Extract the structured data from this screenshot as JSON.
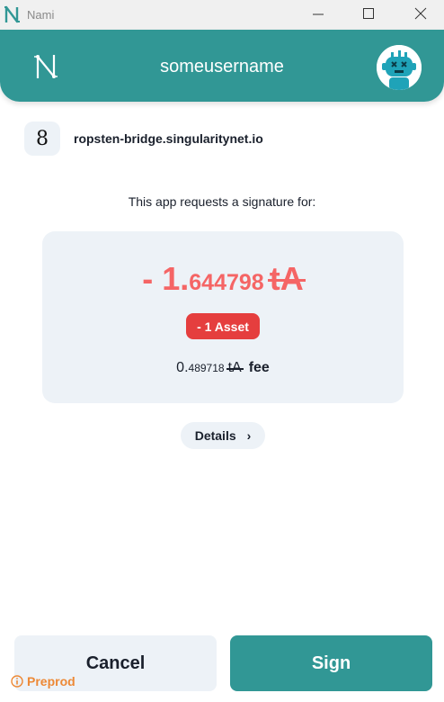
{
  "window": {
    "title": "Nami",
    "minimize_icon": "minimize-icon",
    "maximize_icon": "maximize-icon",
    "close_icon": "close-icon"
  },
  "header": {
    "username": "someusername",
    "logo_icon": "nami-logo-icon",
    "avatar_icon": "robot-avatar-icon",
    "background_color": "#319795"
  },
  "dapp": {
    "icon_glyph": "8",
    "url": "ropsten-bridge.singularitynet.io"
  },
  "request_text": "This app requests a signature for:",
  "summary": {
    "amount_prefix": "- 1.",
    "amount_decimals": "644798",
    "amount_currency": "tA",
    "amount_color": "#f56565",
    "asset_badge": "- 1 Asset",
    "badge_color": "#e53e3e",
    "fee_int": "0.",
    "fee_decimals": "489718",
    "fee_currency": "tA",
    "fee_label": "fee"
  },
  "details_button": {
    "label": "Details",
    "chevron": "›"
  },
  "actions": {
    "cancel_label": "Cancel",
    "sign_label": "Sign"
  },
  "network": {
    "label": "Preprod",
    "icon": "info-icon",
    "color": "#ed8936"
  }
}
